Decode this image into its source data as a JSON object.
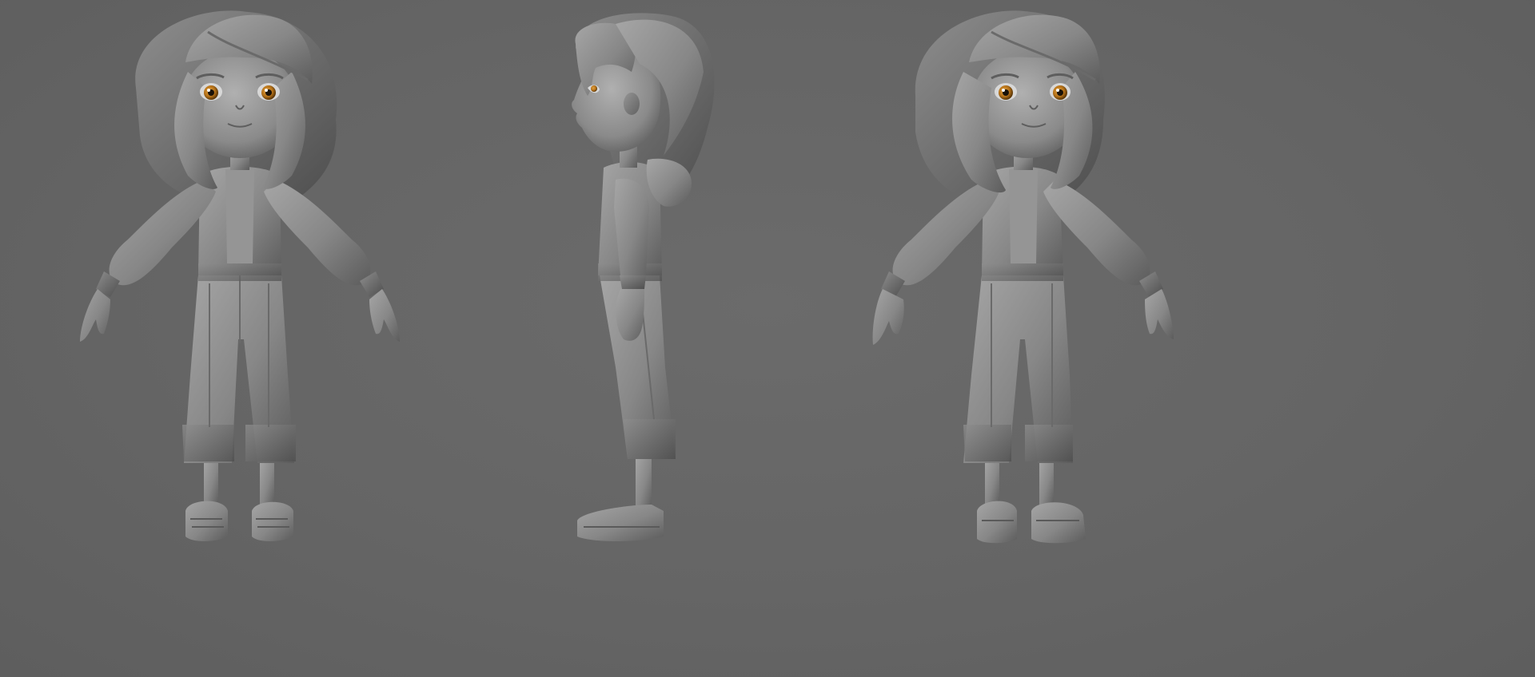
{
  "scene": {
    "background_color": "#666666",
    "clay_color": "#8a8a8a",
    "clay_shadow_color": "#5a5a5a",
    "clay_highlight_color": "#b0b0b0",
    "iris_color": "#b8741a",
    "views": [
      {
        "id": "front",
        "icon": "character-front-view"
      },
      {
        "id": "side",
        "icon": "character-side-view"
      },
      {
        "id": "three-quarter",
        "icon": "character-three-quarter-view"
      }
    ]
  }
}
